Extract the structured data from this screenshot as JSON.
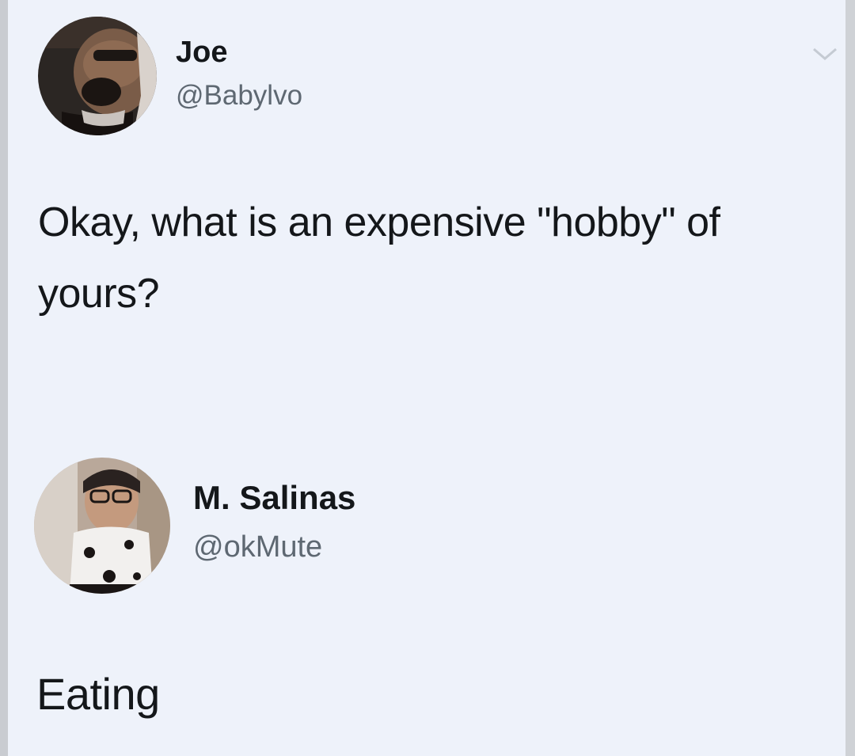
{
  "tweets": [
    {
      "author": {
        "name": "Joe",
        "handle": "@Babylvo"
      },
      "text": "Okay, what is an expensive \"hobby\" of yours?"
    },
    {
      "author": {
        "name": "M. Salinas",
        "handle": "@okMute"
      },
      "text": "Eating"
    }
  ],
  "icons": {
    "menu": "chevron-down-icon"
  },
  "colors": {
    "background": "#eef2fa",
    "name_text": "#14171a",
    "handle_text": "#5e6872"
  }
}
